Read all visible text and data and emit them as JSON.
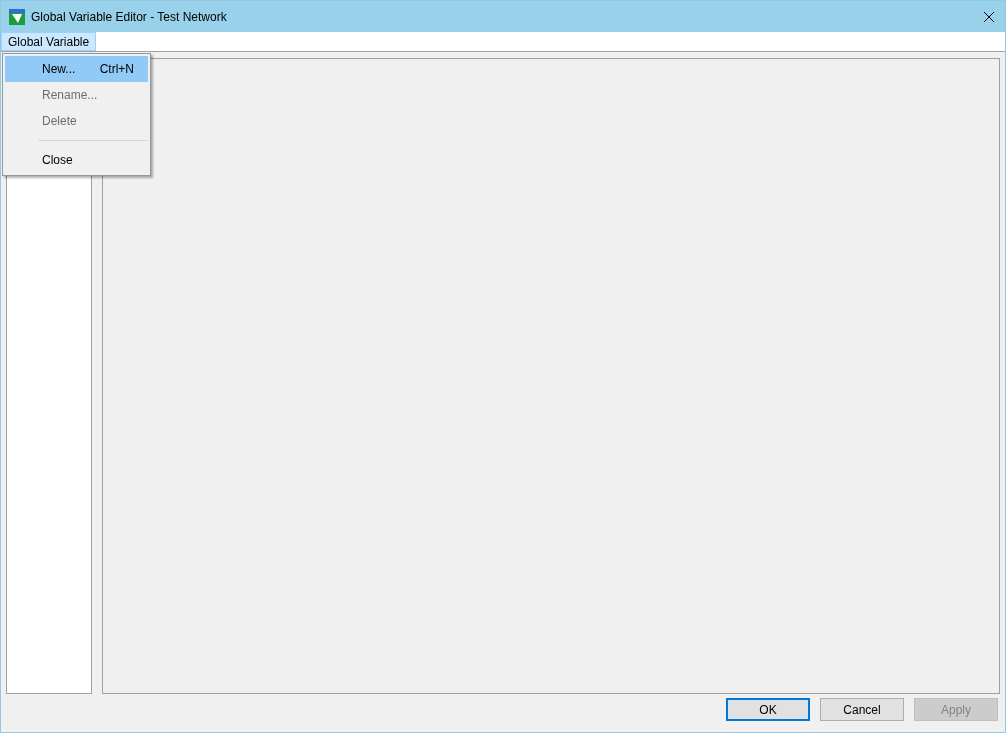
{
  "window": {
    "title": "Global Variable Editor - Test Network"
  },
  "menubar": [
    {
      "label": "Global Variable",
      "selected": true
    }
  ],
  "menu": [
    {
      "kind": "item",
      "label": "New...",
      "shortcut": "Ctrl+N",
      "selected": true,
      "disabled": false
    },
    {
      "kind": "item",
      "label": "Rename...",
      "selected": false,
      "disabled": true
    },
    {
      "kind": "item",
      "label": "Delete",
      "selected": false,
      "disabled": true
    },
    {
      "kind": "separator"
    },
    {
      "kind": "item",
      "label": "Close",
      "selected": false,
      "disabled": false
    }
  ],
  "buttons": [
    {
      "label": "OK",
      "default": true,
      "disabled": false
    },
    {
      "label": "Cancel",
      "default": false,
      "disabled": false
    },
    {
      "label": "Apply",
      "default": false,
      "disabled": true
    }
  ]
}
